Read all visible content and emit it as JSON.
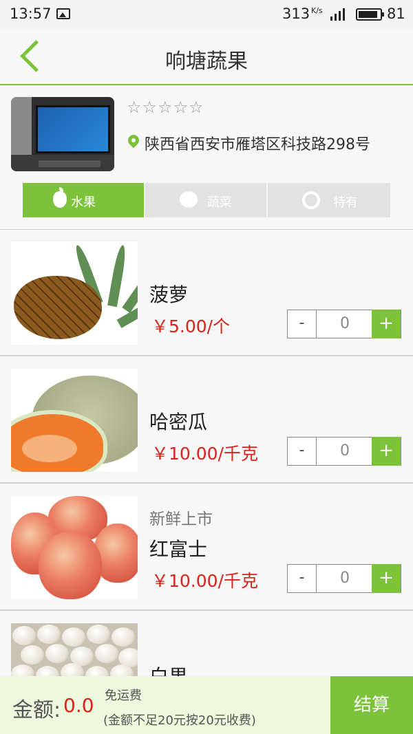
{
  "status_bar": {
    "time": "13:57",
    "speed": "313",
    "speed_unit": "K/s",
    "network": "4G",
    "battery": "81"
  },
  "header": {
    "title": "响塘蔬果"
  },
  "shop": {
    "rating_stars": "☆☆☆☆☆",
    "address": "陕西省西安市雁塔区科技路298号"
  },
  "tabs": [
    {
      "label": "水果",
      "active": true
    },
    {
      "label": "蔬菜",
      "active": false
    },
    {
      "label": "特有",
      "active": false
    }
  ],
  "products": [
    {
      "tag": "",
      "name": "菠萝",
      "price": "￥5.00/个",
      "qty": "0",
      "image": "pineapple"
    },
    {
      "tag": "",
      "name": "哈密瓜",
      "price": "￥10.00/千克",
      "qty": "0",
      "image": "hami-melon"
    },
    {
      "tag": "新鲜上市",
      "name": "红富士",
      "price": "￥10.00/千克",
      "qty": "0",
      "image": "apples"
    },
    {
      "tag": "",
      "name": "白果",
      "price": "",
      "qty": "",
      "image": "ginkgo-nuts"
    }
  ],
  "stepper": {
    "minus": "-",
    "plus": "+"
  },
  "checkout": {
    "amount_label": "金额:",
    "amount_value": "0.0",
    "shipping": "免运费",
    "shipping_note": "(金额不足20元按20元收费)",
    "button": "结算"
  },
  "colors": {
    "accent": "#7cc33b",
    "price": "#d8231b",
    "checkout_bg": "#ecf9dc"
  }
}
